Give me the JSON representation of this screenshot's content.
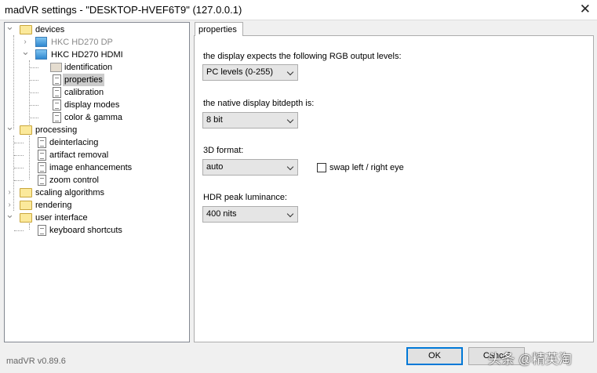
{
  "window": {
    "title": "madVR settings - \"DESKTOP-HVEF6T9\" (127.0.0.1)",
    "close_icon": "close-icon"
  },
  "tree": [
    {
      "label": "devices",
      "level": 0,
      "icon": "folder",
      "expanded": true
    },
    {
      "label": "HKC HD270 DP",
      "level": 1,
      "icon": "monitor",
      "expanded": false,
      "dim": true
    },
    {
      "label": "HKC HD270 HDMI",
      "level": 1,
      "icon": "monitor",
      "expanded": true
    },
    {
      "label": "identification",
      "level": 2,
      "icon": "identification"
    },
    {
      "label": "properties",
      "level": 2,
      "icon": "page",
      "selected": true
    },
    {
      "label": "calibration",
      "level": 2,
      "icon": "page"
    },
    {
      "label": "display modes",
      "level": 2,
      "icon": "page"
    },
    {
      "label": "color & gamma",
      "level": 2,
      "icon": "page"
    },
    {
      "label": "processing",
      "level": 0,
      "icon": "folder",
      "expanded": true
    },
    {
      "label": "deinterlacing",
      "level": 1,
      "icon": "page"
    },
    {
      "label": "artifact removal",
      "level": 1,
      "icon": "page"
    },
    {
      "label": "image enhancements",
      "level": 1,
      "icon": "page"
    },
    {
      "label": "zoom control",
      "level": 1,
      "icon": "page"
    },
    {
      "label": "scaling algorithms",
      "level": 0,
      "icon": "folder",
      "expanded": false
    },
    {
      "label": "rendering",
      "level": 0,
      "icon": "folder",
      "expanded": false
    },
    {
      "label": "user interface",
      "level": 0,
      "icon": "folder",
      "expanded": true
    },
    {
      "label": "keyboard shortcuts",
      "level": 1,
      "icon": "page"
    }
  ],
  "panel": {
    "tab": "properties",
    "rgb_label": "the display expects the following RGB output levels:",
    "rgb_value": "PC levels (0-255)",
    "bitdepth_label": "the native display bitdepth is:",
    "bitdepth_value": "8 bit",
    "format_label": "3D format:",
    "format_value": "auto",
    "swap_label": "swap left / right eye",
    "swap_checked": false,
    "hdr_label": "HDR peak luminance:",
    "hdr_value": "400 nits"
  },
  "footer": {
    "version": "madVR v0.89.6",
    "ok": "OK",
    "cancel": "Cancel",
    "watermark": "头条 @精英淘"
  }
}
